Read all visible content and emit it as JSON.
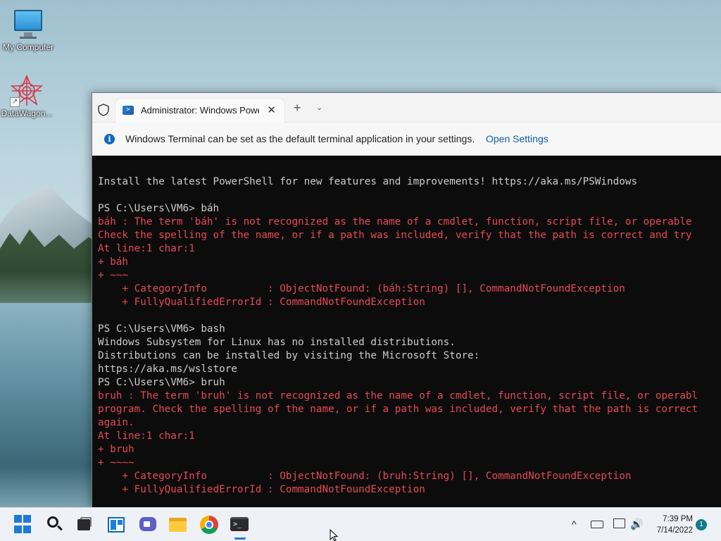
{
  "desktop": {
    "icons": [
      {
        "label": "My Computer",
        "icon": "computer-monitor-icon"
      },
      {
        "label": "DataWagon...",
        "icon": "datawagon-app-icon"
      }
    ]
  },
  "window": {
    "tab_title": "Administrator: Windows PowerShell",
    "new_tab_symbol": "+",
    "dropdown_symbol": "⌄",
    "close_symbol": "✕",
    "infobar": {
      "message": "Windows Terminal can be set as the default terminal application in your settings.",
      "link": "Open Settings"
    }
  },
  "console": {
    "lines": [
      {
        "text": "Install the latest PowerShell for new features and improvements! https://aka.ms/PSWindows",
        "type": "out"
      },
      {
        "text": "",
        "type": "out"
      },
      {
        "text": "PS C:\\Users\\VM6> báh",
        "type": "out"
      },
      {
        "text": "báh : The term 'báh' is not recognized as the name of a cmdlet, function, script file, or operable",
        "type": "err"
      },
      {
        "text": "Check the spelling of the name, or if a path was included, verify that the path is correct and try",
        "type": "err"
      },
      {
        "text": "At line:1 char:1",
        "type": "err"
      },
      {
        "text": "+ báh",
        "type": "err"
      },
      {
        "text": "+ ~~~",
        "type": "err"
      },
      {
        "text": "    + CategoryInfo          : ObjectNotFound: (báh:String) [], CommandNotFoundException",
        "type": "err"
      },
      {
        "text": "    + FullyQualifiedErrorId : CommandNotFoundException",
        "type": "err"
      },
      {
        "text": "",
        "type": "out"
      },
      {
        "text": "PS C:\\Users\\VM6> bash",
        "type": "out"
      },
      {
        "text": "Windows Subsystem for Linux has no installed distributions.",
        "type": "out"
      },
      {
        "text": "Distributions can be installed by visiting the Microsoft Store:",
        "type": "out"
      },
      {
        "text": "https://aka.ms/wslstore",
        "type": "out"
      },
      {
        "text": "PS C:\\Users\\VM6> bruh",
        "type": "out"
      },
      {
        "text": "bruh : The term 'bruh' is not recognized as the name of a cmdlet, function, script file, or operabl",
        "type": "err"
      },
      {
        "text": "program. Check the spelling of the name, or if a path was included, verify that the path is correct",
        "type": "err"
      },
      {
        "text": "again.",
        "type": "err"
      },
      {
        "text": "At line:1 char:1",
        "type": "err"
      },
      {
        "text": "+ bruh",
        "type": "err"
      },
      {
        "text": "+ ~~~~",
        "type": "err"
      },
      {
        "text": "    + CategoryInfo          : ObjectNotFound: (bruh:String) [], CommandNotFoundException",
        "type": "err"
      },
      {
        "text": "    + FullyQualifiedErrorId : CommandNotFoundException",
        "type": "err"
      }
    ]
  },
  "taskbar": {
    "pinned": [
      "start-icon",
      "search-icon",
      "task-view-icon",
      "widgets-icon",
      "chat-icon",
      "file-explorer-icon",
      "chrome-icon",
      "terminal-icon"
    ],
    "terminal_glyph": ">_",
    "tray_chevron": "^",
    "clock": {
      "time": "7:39 PM",
      "date": "7/14/2022"
    },
    "notification_count": "1"
  },
  "colors": {
    "error_text": "#e74856",
    "console_text": "#cccccc",
    "console_bg": "#0c0c0c",
    "link": "#0f5fa8",
    "accent": "#1f7ad6"
  }
}
